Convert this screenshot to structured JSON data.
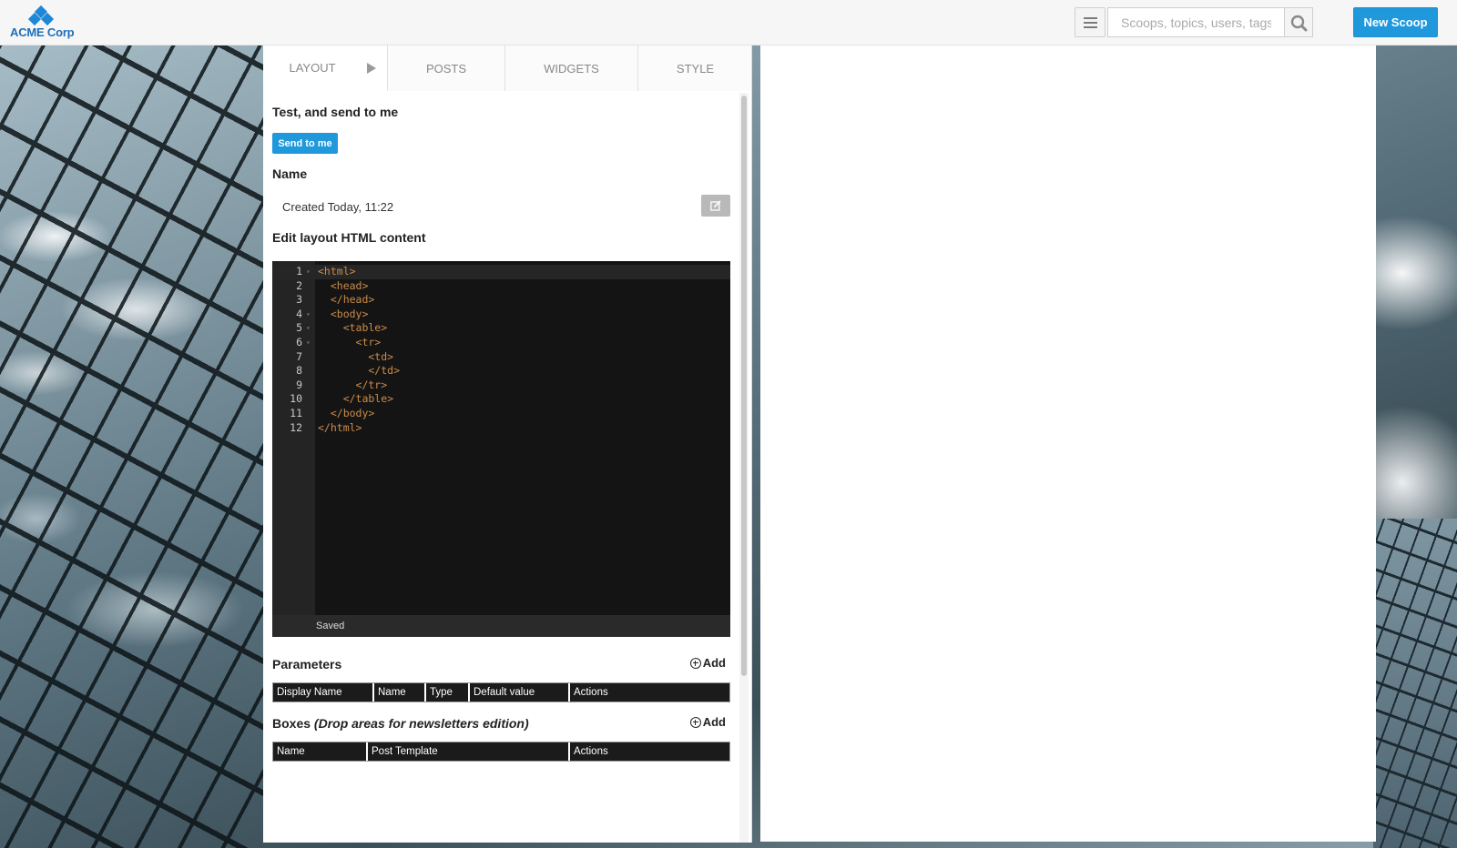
{
  "header": {
    "logo_text": "ACME Corp",
    "search_placeholder": "Scoops, topics, users, tags",
    "new_scoop_label": "New Scoop",
    "menu_icon": "hamburger-menu-icon",
    "search_icon": "magnifier-icon"
  },
  "tabs": [
    {
      "label": "LAYOUT",
      "active": true
    },
    {
      "label": "POSTS",
      "active": false
    },
    {
      "label": "WIDGETS",
      "active": false
    },
    {
      "label": "STYLE",
      "active": false
    }
  ],
  "test_section": {
    "title": "Test, and send to me",
    "button_label": "Send to me"
  },
  "name_section": {
    "title": "Name",
    "value": "Created Today, 11:22",
    "edit_icon": "pencil-square-icon"
  },
  "editor_section": {
    "title": "Edit layout HTML content",
    "lines": [
      {
        "num": "1",
        "code": "<html>",
        "fold": true
      },
      {
        "num": "2",
        "code": "  <head>",
        "fold": false
      },
      {
        "num": "3",
        "code": "  </head>",
        "fold": false
      },
      {
        "num": "4",
        "code": "  <body>",
        "fold": true
      },
      {
        "num": "5",
        "code": "    <table>",
        "fold": true
      },
      {
        "num": "6",
        "code": "      <tr>",
        "fold": true
      },
      {
        "num": "7",
        "code": "        <td>",
        "fold": false
      },
      {
        "num": "8",
        "code": "        </td>",
        "fold": false
      },
      {
        "num": "9",
        "code": "      </tr>",
        "fold": false
      },
      {
        "num": "10",
        "code": "    </table>",
        "fold": false
      },
      {
        "num": "11",
        "code": "  </body>",
        "fold": false
      },
      {
        "num": "12",
        "code": "</html>",
        "fold": false
      }
    ],
    "status": "Saved"
  },
  "parameters": {
    "title": "Parameters",
    "add_label": "Add",
    "columns": [
      "Display Name",
      "Name",
      "Type",
      "Default value",
      "Actions"
    ]
  },
  "boxes": {
    "title": "Boxes",
    "subtitle": "(Drop areas for newsletters edition)",
    "add_label": "Add",
    "columns": [
      "Name",
      "Post Template",
      "Actions"
    ]
  },
  "colors": {
    "accent": "#1f98dc",
    "code_text": "#cc8b4a",
    "editor_bg": "#141414"
  }
}
